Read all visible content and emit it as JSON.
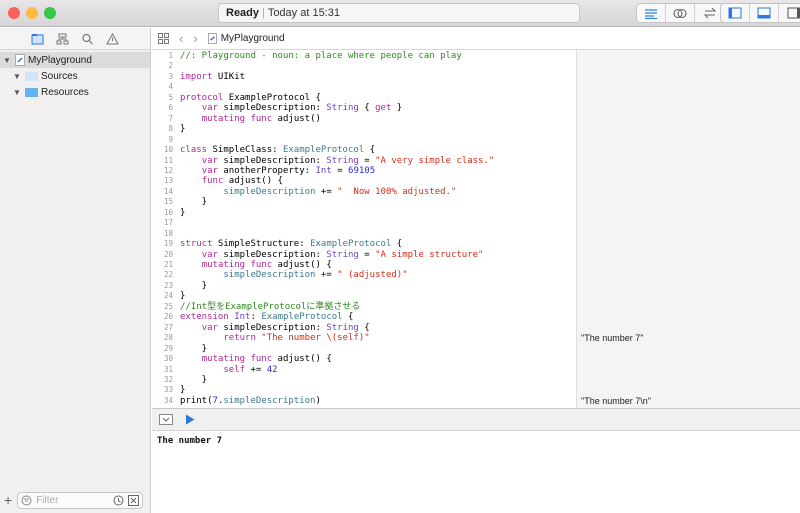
{
  "window": {
    "status_ready": "Ready",
    "status_time": "Today at 15:31",
    "traffic_colors": [
      "#fc605c",
      "#fdbc40",
      "#34c84a"
    ],
    "accent": "#2a7ae2"
  },
  "toolbar": {
    "editor_icons": [
      "standard-editor-icon",
      "assistant-editor-icon",
      "version-editor-icon"
    ],
    "view_icons": [
      "navigator-toggle-icon",
      "debug-area-toggle-icon",
      "utilities-toggle-icon"
    ]
  },
  "sidebar": {
    "nav_icons": [
      "folder-icon",
      "hierarchy-icon",
      "search-icon",
      "warning-icon"
    ],
    "tree": [
      {
        "label": "MyPlayground",
        "level": 0,
        "icon": "playground-file-icon"
      },
      {
        "label": "Sources",
        "level": 1,
        "icon": "folder-icon"
      },
      {
        "label": "Resources",
        "level": 1,
        "icon": "folder-icon"
      }
    ],
    "filter_placeholder": "Filter"
  },
  "jumpbar": {
    "file": "MyPlayground"
  },
  "code": [
    [
      [
        "comment",
        "//: Playground - noun: a place where people can play"
      ]
    ],
    [],
    [
      [
        "kw",
        "import"
      ],
      [
        "plain",
        " UIKit"
      ]
    ],
    [],
    [
      [
        "kw",
        "protocol"
      ],
      [
        "plain",
        " ExampleProtocol {"
      ]
    ],
    [
      [
        "plain",
        "    "
      ],
      [
        "kw",
        "var"
      ],
      [
        "plain",
        " simpleDescription: "
      ],
      [
        "type",
        "String"
      ],
      [
        "plain",
        " { "
      ],
      [
        "kw",
        "get"
      ],
      [
        "plain",
        " }"
      ]
    ],
    [
      [
        "plain",
        "    "
      ],
      [
        "kw",
        "mutating func"
      ],
      [
        "plain",
        " adjust()"
      ]
    ],
    [
      [
        "plain",
        "}"
      ]
    ],
    [],
    [
      [
        "kw",
        "class"
      ],
      [
        "plain",
        " SimpleClass: "
      ],
      [
        "ptype",
        "ExampleProtocol"
      ],
      [
        "plain",
        " {"
      ]
    ],
    [
      [
        "plain",
        "    "
      ],
      [
        "kw",
        "var"
      ],
      [
        "plain",
        " simpleDescription: "
      ],
      [
        "type",
        "String"
      ],
      [
        "plain",
        " = "
      ],
      [
        "str",
        "\"A very simple class.\""
      ]
    ],
    [
      [
        "plain",
        "    "
      ],
      [
        "kw",
        "var"
      ],
      [
        "plain",
        " anotherProperty: "
      ],
      [
        "type",
        "Int"
      ],
      [
        "plain",
        " = "
      ],
      [
        "num",
        "69105"
      ]
    ],
    [
      [
        "plain",
        "    "
      ],
      [
        "kw",
        "func"
      ],
      [
        "plain",
        " adjust() {"
      ]
    ],
    [
      [
        "plain",
        "        "
      ],
      [
        "id",
        "simpleDescription"
      ],
      [
        "plain",
        " += "
      ],
      [
        "str",
        "\"  Now 100% adjusted.\""
      ]
    ],
    [
      [
        "plain",
        "    }"
      ]
    ],
    [
      [
        "plain",
        "}"
      ]
    ],
    [],
    [],
    [
      [
        "kw",
        "struct"
      ],
      [
        "plain",
        " SimpleStructure: "
      ],
      [
        "ptype",
        "ExampleProtocol"
      ],
      [
        "plain",
        " {"
      ]
    ],
    [
      [
        "plain",
        "    "
      ],
      [
        "kw",
        "var"
      ],
      [
        "plain",
        " simpleDescription: "
      ],
      [
        "type",
        "String"
      ],
      [
        "plain",
        " = "
      ],
      [
        "str",
        "\"A simple structure\""
      ]
    ],
    [
      [
        "plain",
        "    "
      ],
      [
        "kw",
        "mutating func"
      ],
      [
        "plain",
        " adjust() {"
      ]
    ],
    [
      [
        "plain",
        "        "
      ],
      [
        "id",
        "simpleDescription"
      ],
      [
        "plain",
        " += "
      ],
      [
        "str",
        "\" (adjusted)\""
      ]
    ],
    [
      [
        "plain",
        "    }"
      ]
    ],
    [
      [
        "plain",
        "}"
      ]
    ],
    [
      [
        "comment",
        "//Int型をExampleProtocolに準拠させる"
      ]
    ],
    [
      [
        "kw",
        "extension"
      ],
      [
        "plain",
        " "
      ],
      [
        "type",
        "Int"
      ],
      [
        "plain",
        ": "
      ],
      [
        "ptype",
        "ExampleProtocol"
      ],
      [
        "plain",
        " {"
      ]
    ],
    [
      [
        "plain",
        "    "
      ],
      [
        "kw",
        "var"
      ],
      [
        "plain",
        " simpleDescription: "
      ],
      [
        "type",
        "String"
      ],
      [
        "plain",
        " {"
      ]
    ],
    [
      [
        "plain",
        "        "
      ],
      [
        "kw",
        "return"
      ],
      [
        "plain",
        " "
      ],
      [
        "str",
        "\"The number \\(self)\""
      ]
    ],
    [
      [
        "plain",
        "    }"
      ]
    ],
    [
      [
        "plain",
        "    "
      ],
      [
        "kw",
        "mutating func"
      ],
      [
        "plain",
        " adjust() {"
      ]
    ],
    [
      [
        "plain",
        "        "
      ],
      [
        "kw",
        "self"
      ],
      [
        "plain",
        " += "
      ],
      [
        "num",
        "42"
      ]
    ],
    [
      [
        "plain",
        "    }"
      ]
    ],
    [
      [
        "plain",
        "}"
      ]
    ],
    [
      [
        "plain",
        "print("
      ],
      [
        "num",
        "7"
      ],
      [
        "plain",
        "."
      ],
      [
        "id",
        "simpleDescription"
      ],
      [
        "plain",
        ")"
      ]
    ]
  ],
  "results": [
    {
      "line": 28,
      "text": "\"The number 7\""
    },
    {
      "line": 34,
      "text": "\"The number 7\\n\""
    }
  ],
  "console": {
    "output": "The number 7"
  }
}
